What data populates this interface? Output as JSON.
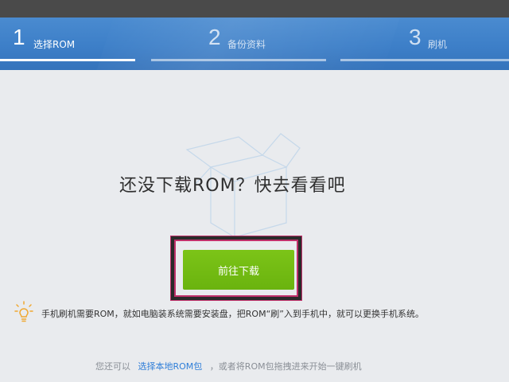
{
  "steps": [
    {
      "number": "1",
      "label": "选择ROM",
      "active": true
    },
    {
      "number": "2",
      "label": "备份资料",
      "active": false
    },
    {
      "number": "3",
      "label": "刷机",
      "active": false
    }
  ],
  "main": {
    "headline": "还没下载ROM？快去看看吧",
    "download_button": "前往下载"
  },
  "tip": {
    "icon": "lightbulb-icon",
    "text": "手机刷机需要ROM，就如电脑装系统需要安装盘，把ROM“刷”入到手机中，就可以更换手机系统。"
  },
  "footer": {
    "prefix": "您还可以",
    "link": "选择本地ROM包",
    "suffix": "，或者将ROM包拖拽进来开始一键刷机"
  },
  "colors": {
    "header_blue": "#3d7fc8",
    "button_green": "#6ab30e",
    "link_blue": "#2f7ed8",
    "highlight_frame": "#2a2a2a"
  }
}
